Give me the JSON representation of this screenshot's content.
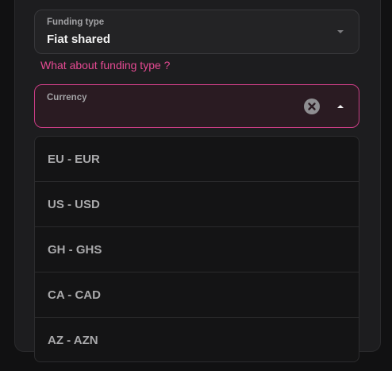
{
  "funding_type": {
    "label": "Funding type",
    "value": "Fiat shared",
    "dropdown_icon": "chevron-down-icon"
  },
  "funding_help_link": "What about funding type ?",
  "currency": {
    "label": "Currency",
    "value": "",
    "clear_icon": "close-circle-icon",
    "toggle_icon": "chevron-up-icon",
    "accent_color": "#c93d84"
  },
  "currency_options": [
    "EU - EUR",
    "US - USD",
    "GH - GHS",
    "CA - CAD",
    "AZ - AZN"
  ],
  "colors": {
    "background": "#111112",
    "panel": "#1d1d1f",
    "link": "#e64a93",
    "focus_border": "#c93d84"
  }
}
